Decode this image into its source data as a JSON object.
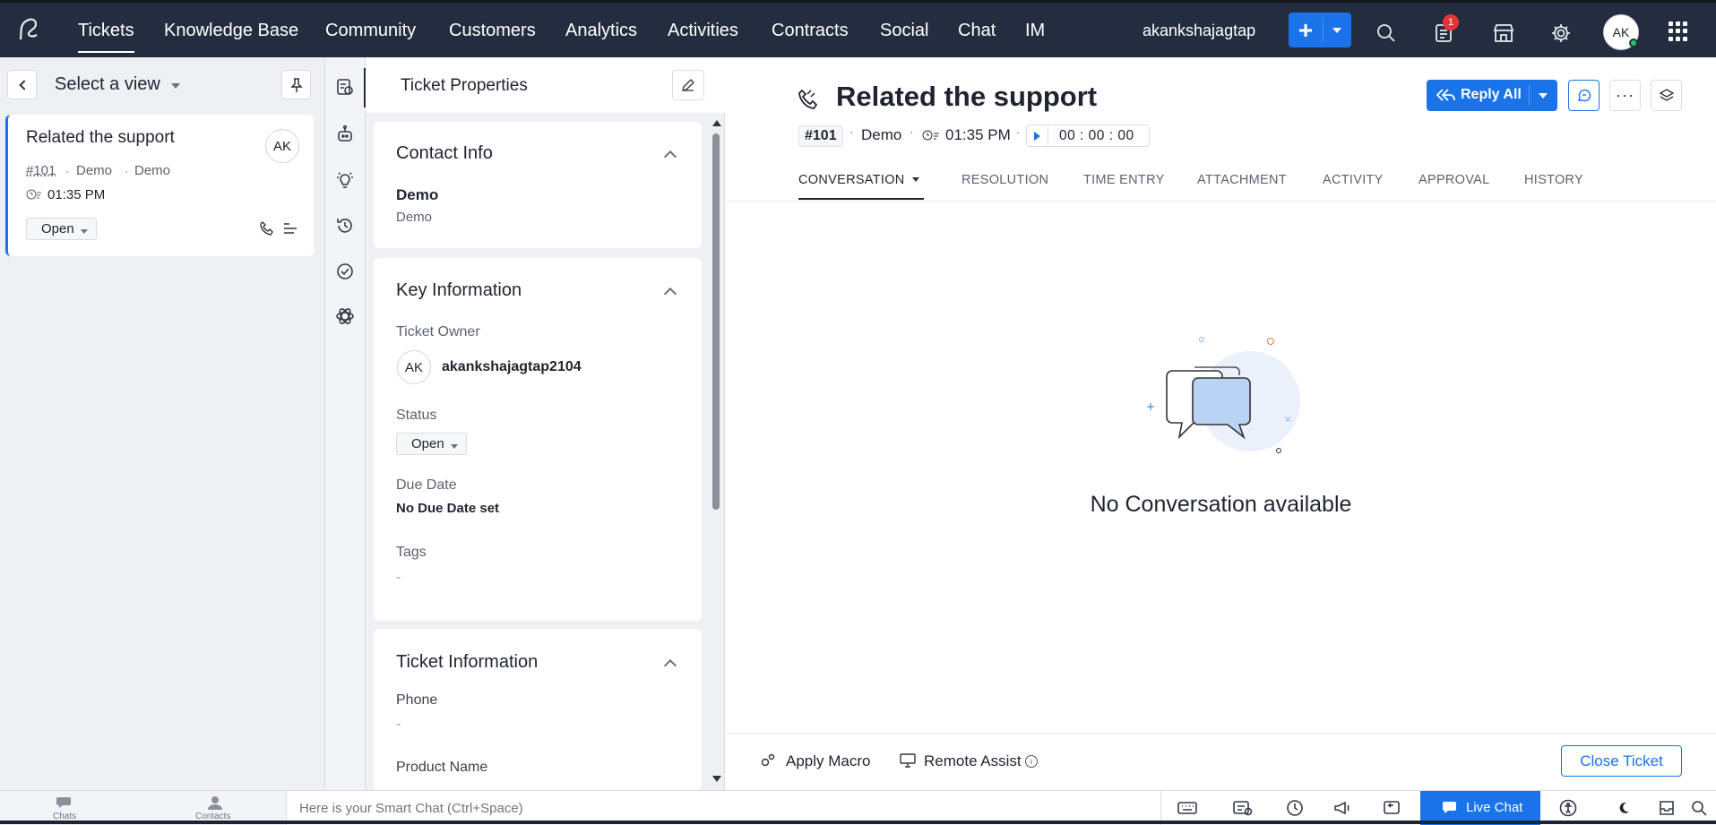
{
  "nav": {
    "items": [
      "Tickets",
      "Knowledge Base",
      "Community",
      "Customers",
      "Analytics",
      "Activities",
      "Contracts",
      "Social",
      "Chat",
      "IM"
    ],
    "user": "akankshajagtap",
    "notification_count": "1",
    "avatar": "AK"
  },
  "left": {
    "view_label": "Select a view",
    "ticket": {
      "title": "Related the support",
      "avatar": "AK",
      "number": "#101",
      "contact": "Demo",
      "account": "Demo",
      "time": "01:35 PM",
      "status": "Open"
    }
  },
  "properties": {
    "header": "Ticket Properties",
    "contact_info": {
      "title": "Contact Info",
      "name": "Demo",
      "account": "Demo"
    },
    "key_info": {
      "title": "Key Information",
      "owner_label": "Ticket Owner",
      "owner_avatar": "AK",
      "owner_name": "akankshajagtap2104",
      "status_label": "Status",
      "status_value": "Open",
      "due_label": "Due Date",
      "due_value": "No Due Date set",
      "tags_label": "Tags",
      "tags_value": "-"
    },
    "ticket_info": {
      "title": "Ticket Information",
      "phone_label": "Phone",
      "phone_value": "-",
      "product_label": "Product Name"
    }
  },
  "main": {
    "title": "Related the support",
    "number": "#101",
    "contact": "Demo",
    "time": "01:35 PM",
    "timer": "00 : 00 : 00",
    "reply_all": "Reply All",
    "tabs": [
      "CONVERSATION",
      "RESOLUTION",
      "TIME ENTRY",
      "ATTACHMENT",
      "ACTIVITY",
      "APPROVAL",
      "HISTORY"
    ],
    "empty_text": "No Conversation available",
    "apply_macro": "Apply Macro",
    "remote_assist": "Remote Assist",
    "close_ticket": "Close Ticket"
  },
  "bottom": {
    "chats": "Chats",
    "contacts": "Contacts",
    "smart_chat_placeholder": "Here is your Smart Chat (Ctrl+Space)",
    "live_chat": "Live Chat"
  },
  "colors": {
    "nav_bg": "#242d3f",
    "accent": "#1a73e8",
    "badge": "#e5353b"
  }
}
